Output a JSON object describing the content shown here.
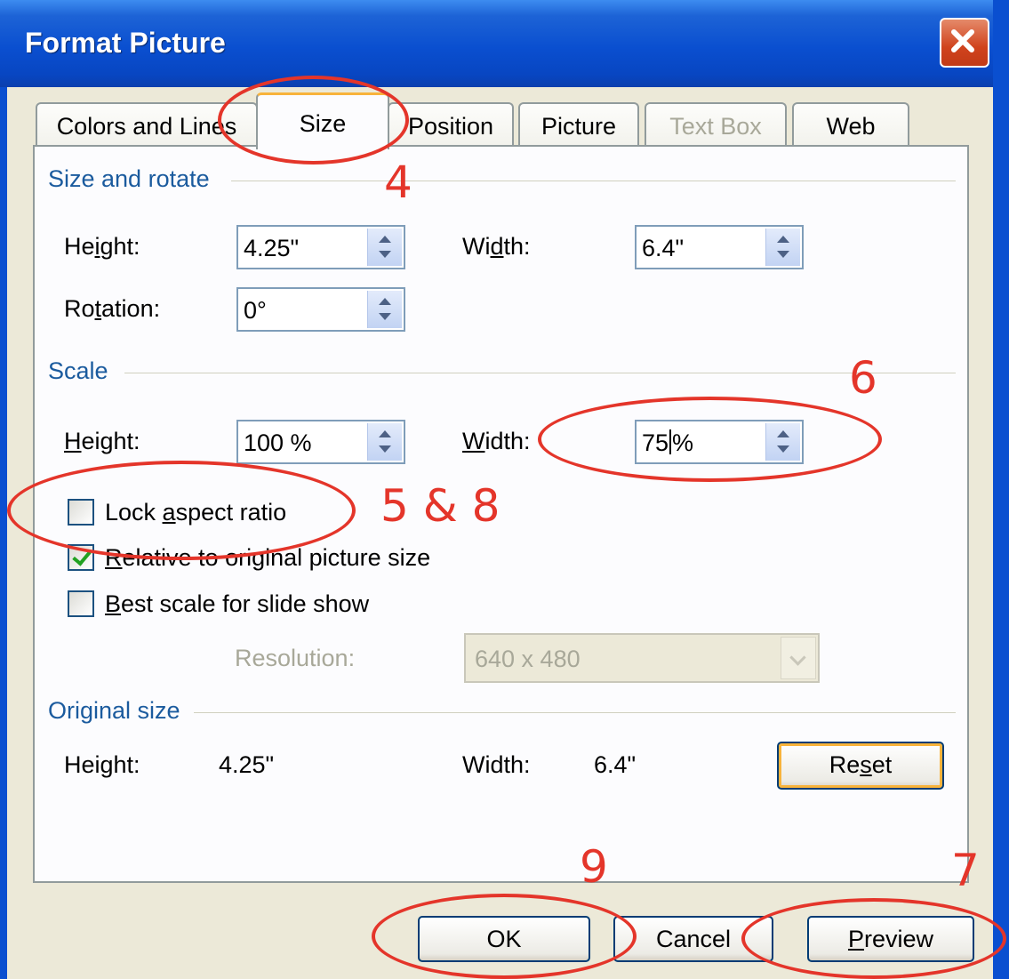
{
  "dialog": {
    "title": "Format Picture"
  },
  "tabs": [
    {
      "label": "Colors and Lines",
      "state": "normal"
    },
    {
      "label": "Size",
      "state": "active"
    },
    {
      "label": "Position",
      "state": "normal"
    },
    {
      "label": "Picture",
      "state": "normal"
    },
    {
      "label": "Text Box",
      "state": "disabled"
    },
    {
      "label": "Web",
      "state": "normal"
    }
  ],
  "size_rotate": {
    "group_label": "Size and rotate",
    "height_label": "Height:",
    "height_value": "4.25\"",
    "width_label": "Width:",
    "width_value": "6.4\"",
    "rotation_label": "Rotation:",
    "rotation_value": "0°"
  },
  "scale": {
    "group_label": "Scale",
    "height_label": "Height:",
    "height_value": "100 %",
    "width_label": "Width:",
    "width_value_before_cursor": "75",
    "width_value_after_cursor": "%",
    "lock_aspect_label": "Lock aspect ratio",
    "lock_aspect_checked": false,
    "relative_label": "Relative to original picture size",
    "relative_checked": true,
    "best_scale_label": "Best scale for slide show",
    "best_scale_checked": false,
    "resolution_label": "Resolution:",
    "resolution_value": "640 x 480"
  },
  "original_size": {
    "group_label": "Original size",
    "height_label": "Height:",
    "height_value": "4.25\"",
    "width_label": "Width:",
    "width_value": "6.4\"",
    "reset_label": "Reset"
  },
  "buttons": {
    "ok": "OK",
    "cancel": "Cancel",
    "preview": "Preview"
  },
  "annotations": {
    "n4": "4",
    "n6": "6",
    "n5_8": "5 & 8",
    "n9": "9",
    "n7": "7",
    "color": "#e4352a"
  },
  "colors": {
    "title_bar": "#0a4fd0",
    "group_label": "#1b5b9e",
    "focus_border": "#f8b33b"
  }
}
